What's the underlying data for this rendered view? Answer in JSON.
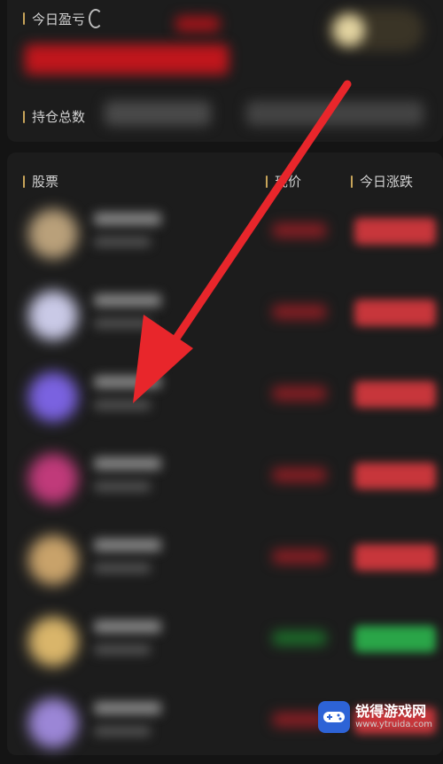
{
  "summary": {
    "today_pnl_label": "今日盈亏",
    "position_total_label": "持仓总数"
  },
  "list": {
    "columns": [
      "股票",
      "现价",
      "今日涨跌"
    ],
    "rows": [
      {
        "logo_color": "#b9a07a",
        "price_color": "#8a1e24",
        "change_color": "#c7363b"
      },
      {
        "logo_color": "#c9c9e6",
        "price_color": "#8a1e24",
        "change_color": "#c7363b"
      },
      {
        "logo_color": "#7a62e0",
        "price_color": "#8a1e24",
        "change_color": "#c7363b"
      },
      {
        "logo_color": "#c03a7a",
        "price_color": "#8a1e24",
        "change_color": "#c7363b"
      },
      {
        "logo_color": "#c8a26a",
        "price_color": "#8a1e24",
        "change_color": "#c7363b"
      },
      {
        "logo_color": "#d9b56a",
        "price_color": "#1d6e2a",
        "change_color": "#2aa548"
      },
      {
        "logo_color": "#9b86d6",
        "price_color": "#8a1e24",
        "change_color": "#c7363b"
      }
    ]
  },
  "colors": {
    "accent_bar": "#c8a55a",
    "arrow": "#e8262b"
  },
  "watermark": {
    "brand": "锐得游戏网",
    "url": "www.ytruida.com"
  }
}
